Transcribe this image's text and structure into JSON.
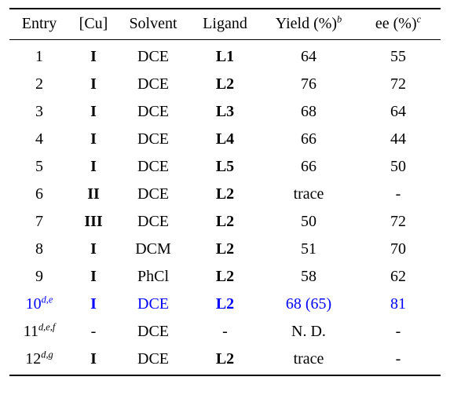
{
  "table": {
    "caption": "",
    "highlight_color": "#0000ff",
    "text_color": "#000000",
    "background_color": "#ffffff",
    "columns": [
      {
        "key": "entry",
        "label": "Entry",
        "marker": ""
      },
      {
        "key": "cu",
        "label": "[Cu]",
        "marker": ""
      },
      {
        "key": "solvent",
        "label": "Solvent",
        "marker": ""
      },
      {
        "key": "ligand",
        "label": "Ligand",
        "marker": ""
      },
      {
        "key": "yield",
        "label": "Yield (%)",
        "marker": "b"
      },
      {
        "key": "ee",
        "label": "ee (%)",
        "marker": "c"
      }
    ],
    "rows": [
      {
        "entry": "1",
        "entry_marker": "",
        "cu": "I",
        "solvent": "DCE",
        "ligand": "L1",
        "yield": "64",
        "ee": "55",
        "highlight": false
      },
      {
        "entry": "2",
        "entry_marker": "",
        "cu": "I",
        "solvent": "DCE",
        "ligand": "L2",
        "yield": "76",
        "ee": "72",
        "highlight": false
      },
      {
        "entry": "3",
        "entry_marker": "",
        "cu": "I",
        "solvent": "DCE",
        "ligand": "L3",
        "yield": "68",
        "ee": "64",
        "highlight": false
      },
      {
        "entry": "4",
        "entry_marker": "",
        "cu": "I",
        "solvent": "DCE",
        "ligand": "L4",
        "yield": "66",
        "ee": "44",
        "highlight": false
      },
      {
        "entry": "5",
        "entry_marker": "",
        "cu": "I",
        "solvent": "DCE",
        "ligand": "L5",
        "yield": "66",
        "ee": "50",
        "highlight": false
      },
      {
        "entry": "6",
        "entry_marker": "",
        "cu": "II",
        "solvent": "DCE",
        "ligand": "L2",
        "yield": "trace",
        "ee": "-",
        "highlight": false
      },
      {
        "entry": "7",
        "entry_marker": "",
        "cu": "III",
        "solvent": "DCE",
        "ligand": "L2",
        "yield": "50",
        "ee": "72",
        "highlight": false
      },
      {
        "entry": "8",
        "entry_marker": "",
        "cu": "I",
        "solvent": "DCM",
        "ligand": "L2",
        "yield": "51",
        "ee": "70",
        "highlight": false
      },
      {
        "entry": "9",
        "entry_marker": "",
        "cu": "I",
        "solvent": "PhCl",
        "ligand": "L2",
        "yield": "58",
        "ee": "62",
        "highlight": false
      },
      {
        "entry": "10",
        "entry_marker": "d,e",
        "cu": "I",
        "solvent": "DCE",
        "ligand": "L2",
        "yield": "68 (65)",
        "ee": "81",
        "highlight": true
      },
      {
        "entry": "11",
        "entry_marker": "d,e,f",
        "cu": "-",
        "solvent": "DCE",
        "ligand": "-",
        "yield": "N. D.",
        "ee": "-",
        "highlight": false
      },
      {
        "entry": "12",
        "entry_marker": "d,g",
        "cu": "I",
        "solvent": "DCE",
        "ligand": "L2",
        "yield": "trace",
        "ee": "-",
        "highlight": false
      }
    ]
  }
}
